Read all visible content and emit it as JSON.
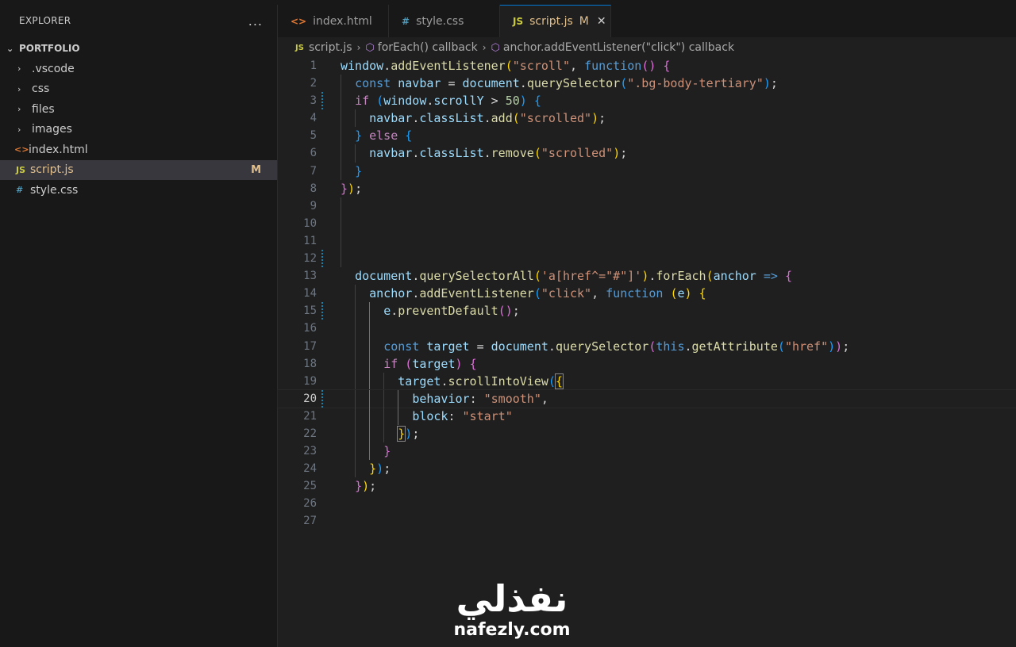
{
  "sidebar": {
    "title": "EXPLORER",
    "more_icon": "...",
    "folder": "PORTFOLIO",
    "items": [
      {
        "label": ".vscode",
        "type": "folder"
      },
      {
        "label": "css",
        "type": "folder"
      },
      {
        "label": "files",
        "type": "folder"
      },
      {
        "label": "images",
        "type": "folder"
      },
      {
        "label": "index.html",
        "type": "html",
        "icon": "<>"
      },
      {
        "label": "script.js",
        "type": "js",
        "icon": "JS",
        "badge": "M",
        "active": true
      },
      {
        "label": "style.css",
        "type": "css",
        "icon": "#"
      }
    ]
  },
  "tabs": [
    {
      "label": "index.html",
      "icon": "<>"
    },
    {
      "label": "style.css",
      "icon": "#"
    },
    {
      "label": "script.js",
      "icon": "JS",
      "badge": "M",
      "close": "✕",
      "active": true
    }
  ],
  "breadcrumb": {
    "file_icon": "JS",
    "file": "script.js",
    "sep": "›",
    "crumb1": "forEach() callback",
    "crumb2": "anchor.addEventListener(\"click\") callback"
  },
  "editor": {
    "line_numbers": [
      "1",
      "2",
      "3",
      "4",
      "5",
      "6",
      "7",
      "8",
      "9",
      "10",
      "11",
      "12",
      "13",
      "14",
      "15",
      "16",
      "17",
      "18",
      "19",
      "20",
      "21",
      "22",
      "23",
      "24",
      "25",
      "26",
      "27"
    ],
    "current_line": 20,
    "modified_lines": [
      3,
      12,
      15,
      20
    ]
  },
  "watermark": {
    "arabic": "نفذلي",
    "domain": "nafezly.com"
  },
  "colors": {
    "modified": "#e2c08d",
    "accent": "#0078d4",
    "editor_bg": "#1f1f1f",
    "sidebar_bg": "#181818"
  }
}
